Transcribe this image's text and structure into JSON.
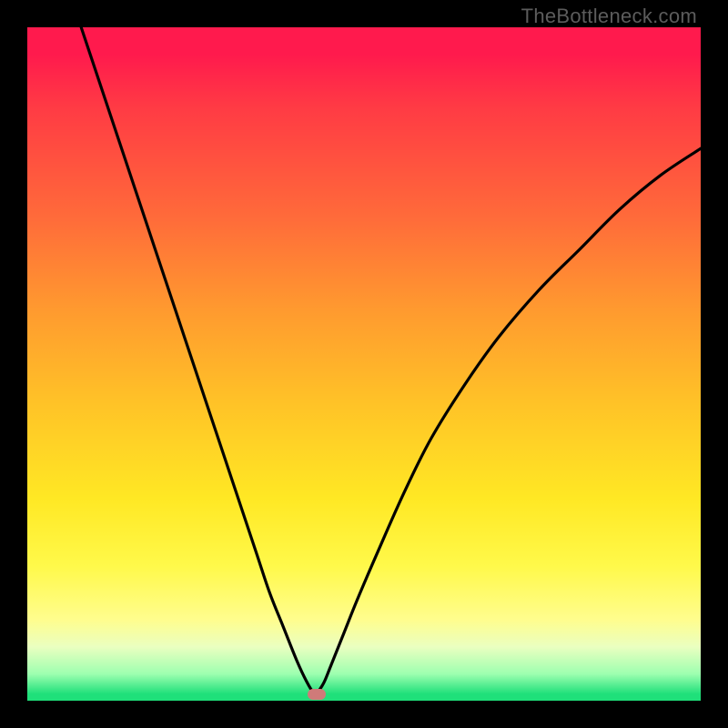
{
  "watermark": "TheBottleneck.com",
  "chart_data": {
    "type": "line",
    "title": "",
    "xlabel": "",
    "ylabel": "",
    "xlim": [
      0,
      100
    ],
    "ylim": [
      0,
      100
    ],
    "series": [
      {
        "name": "curve",
        "x": [
          8,
          10,
          13,
          16,
          19,
          22,
          25,
          28,
          31,
          34,
          36,
          38,
          40,
          41.5,
          42.5,
          43,
          44,
          45,
          47,
          49,
          52,
          56,
          60,
          65,
          70,
          76,
          82,
          88,
          94,
          100
        ],
        "values": [
          100,
          94,
          85,
          76,
          67,
          58,
          49,
          40,
          31,
          22,
          16,
          11,
          6,
          2.8,
          1.2,
          1.2,
          2.6,
          5,
          10,
          15,
          22,
          31,
          39,
          47,
          54,
          61,
          67,
          73,
          78,
          82
        ]
      }
    ],
    "marker": {
      "x": 43,
      "y": 0.9,
      "color": "#cf7a79"
    },
    "gradient_stops": [
      {
        "pos": 0,
        "color": "#ff1a4d"
      },
      {
        "pos": 28,
        "color": "#ff6a3a"
      },
      {
        "pos": 56,
        "color": "#ffc327"
      },
      {
        "pos": 80,
        "color": "#fff94a"
      },
      {
        "pos": 96,
        "color": "#9effb0"
      },
      {
        "pos": 100,
        "color": "#1fe07a"
      }
    ]
  }
}
